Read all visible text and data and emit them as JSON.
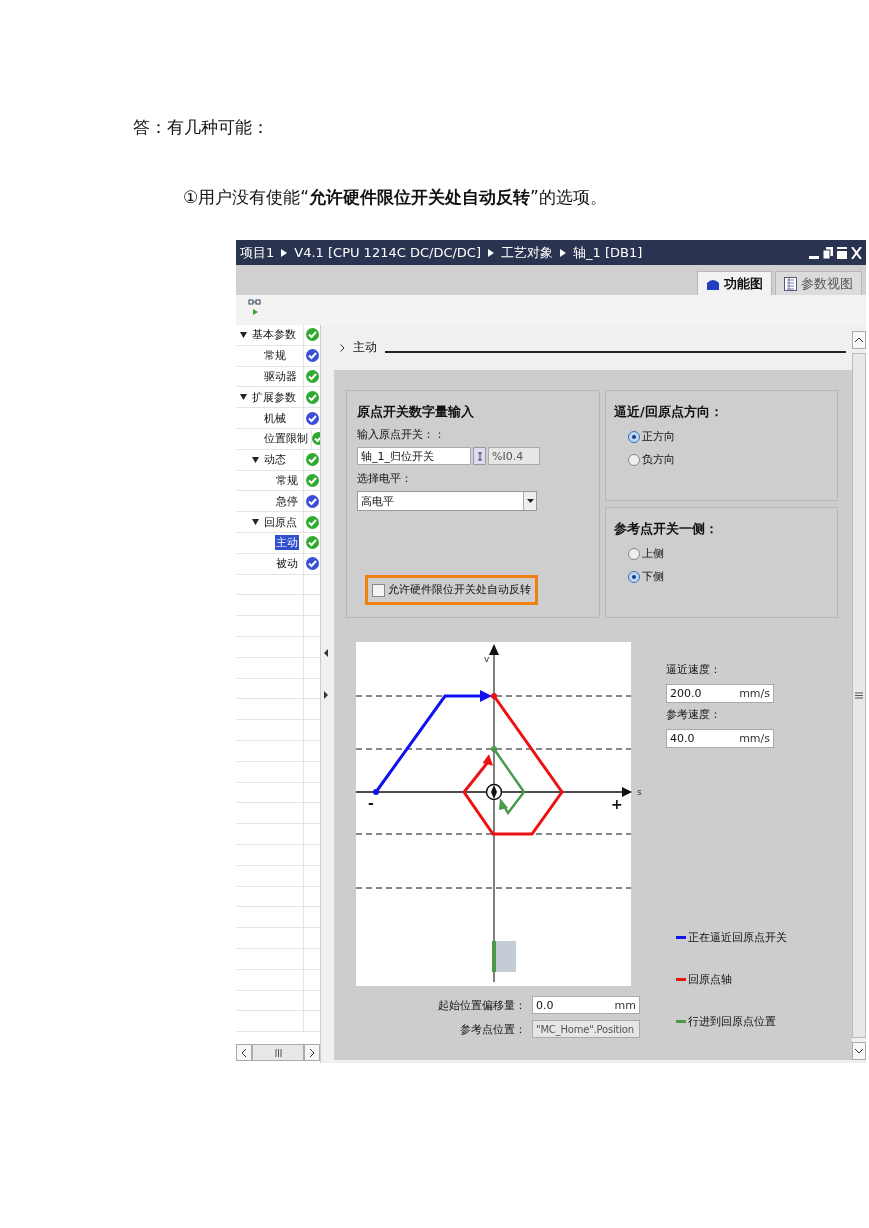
{
  "answer_intro": "答：有几种可能：",
  "reason": "①用户没有使能“**允许硬件限位开关处自动反转**”的选项。",
  "window": {
    "breadcrumb": [
      "项目1",
      "V4.1 [CPU 1214C DC/DC/DC]",
      "工艺对象",
      "轴_1 [DB1]"
    ]
  },
  "view_tabs": [
    {
      "label": "功能图",
      "selected": true
    },
    {
      "label": "参数视图",
      "selected": false
    }
  ],
  "tree": [
    {
      "label": "基本参数",
      "expanded": true,
      "selected": false,
      "color": "#2eaa2e",
      "children": [
        {
          "label": "常规",
          "selected": false,
          "color": "#3a4fd8"
        },
        {
          "label": "驱动器",
          "selected": false,
          "color": "#2eaa2e"
        }
      ]
    },
    {
      "label": "扩展参数",
      "expanded": true,
      "selected": false,
      "color": "#2eaa2e",
      "children": [
        {
          "label": "机械",
          "selected": false,
          "color": "#3a4fd8"
        },
        {
          "label": "位置限制",
          "selected": false,
          "color": "#2eaa2e"
        },
        {
          "label": "动态",
          "expanded": true,
          "selected": false,
          "color": "#2eaa2e",
          "children": [
            {
              "label": "常规",
              "selected": false,
              "color": "#2eaa2e"
            },
            {
              "label": "急停",
              "selected": false,
              "color": "#3a4fd8"
            }
          ]
        },
        {
          "label": "回原点",
          "expanded": true,
          "selected": false,
          "color": "#2eaa2e",
          "children": [
            {
              "label": "主动",
              "selected": true,
              "color": "#2eaa2e"
            },
            {
              "label": "被动",
              "selected": false,
              "color": "#3a4fd8"
            }
          ]
        }
      ]
    }
  ],
  "section_title": "主动",
  "home_switch_group": {
    "title": "原点开关数字量输入",
    "input_label": "输入原点开关：：",
    "input_value": "轴_1_归位开关",
    "address": "%I0.4",
    "level_label": "选择电平：",
    "level_value": "高电平",
    "auto_reverse": {
      "label": "允许硬件限位开关处自动反转",
      "checked": false,
      "highlighted": true
    }
  },
  "direction_group": {
    "title": "逼近/回原点方向：",
    "options": [
      {
        "label": "正方向",
        "selected": true
      },
      {
        "label": "负方向",
        "selected": false
      }
    ]
  },
  "side_group": {
    "title": "参考点开关一侧：",
    "options": [
      {
        "label": "上侧",
        "selected": false
      },
      {
        "label": "下侧",
        "selected": true
      }
    ]
  },
  "diagram": {
    "v_label": "v",
    "s_label": "s",
    "minus_label": "-",
    "plus_label": "+"
  },
  "speeds": [
    {
      "label": "逼近速度：",
      "value": "200.0",
      "unit": "mm/s"
    },
    {
      "label": "参考速度：",
      "value": "40.0",
      "unit": "mm/s"
    }
  ],
  "legend": [
    {
      "label": "正在逼近回原点开关",
      "color": "#1010f0"
    },
    {
      "label": "回原点轴",
      "color": "#ee1111"
    },
    {
      "label": "行进到回原点位置",
      "color": "#4a9a4a"
    }
  ],
  "offset": {
    "label": "起始位置偏移量：",
    "value": "0.0",
    "unit": "mm"
  },
  "ref_position": {
    "label": "参考点位置：",
    "value": "\"MC_Home\".Position"
  }
}
